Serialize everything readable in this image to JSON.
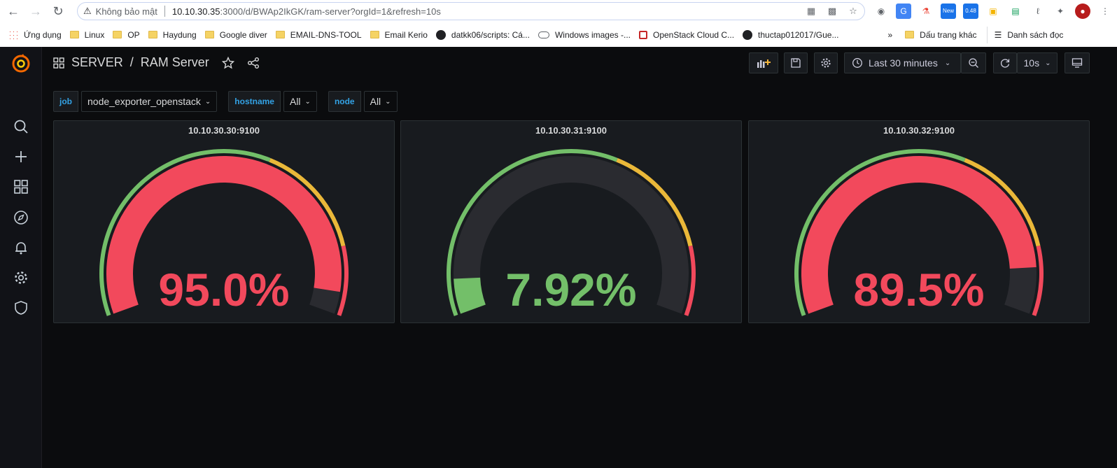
{
  "browser": {
    "security_label": "Không bảo mật",
    "url_host": "10.10.30.35",
    "url_rest": ":3000/d/BWAp2IkGK/ram-server?orgId=1&refresh=10s",
    "bookmarks": [
      {
        "label": "Ứng dụng",
        "icon": "apps-icon"
      },
      {
        "label": "Linux",
        "icon": "folder-icon"
      },
      {
        "label": "OP",
        "icon": "folder-icon"
      },
      {
        "label": "Haydung",
        "icon": "folder-icon"
      },
      {
        "label": "Google diver",
        "icon": "folder-icon"
      },
      {
        "label": "EMAIL-DNS-TOOL",
        "icon": "folder-icon"
      },
      {
        "label": "Email Kerio",
        "icon": "folder-icon"
      },
      {
        "label": "datkk06/scripts: Cá...",
        "icon": "github-icon"
      },
      {
        "label": "Windows images -...",
        "icon": "cloud-icon"
      },
      {
        "label": "OpenStack Cloud C...",
        "icon": "openstack-icon"
      },
      {
        "label": "thuctap012017/Gue...",
        "icon": "github-icon"
      }
    ],
    "more_label": "»",
    "other_bookmarks": "Dấu trang khác",
    "reading_list": "Danh sách đọc",
    "ext_badge": "0.48",
    "ext_new": "New"
  },
  "dashboard": {
    "folder": "SERVER",
    "title": "RAM Server",
    "time_range": "Last 30 minutes",
    "refresh": "10s",
    "variables": [
      {
        "label": "job",
        "value": "node_exporter_openstack"
      },
      {
        "label": "hostname",
        "value": "All"
      },
      {
        "label": "node",
        "value": "All"
      }
    ]
  },
  "colors": {
    "red": "#f2495c",
    "green": "#73bf69",
    "orange": "#eab839",
    "track": "#2a2b30"
  },
  "chart_data": [
    {
      "type": "gauge",
      "title": "10.10.30.30:9100",
      "value": 95.0,
      "display": "95.0%",
      "min": 0,
      "max": 100,
      "thresholds": [
        {
          "from": 0,
          "color": "green"
        },
        {
          "from": 60,
          "color": "orange"
        },
        {
          "from": 85,
          "color": "red"
        }
      ]
    },
    {
      "type": "gauge",
      "title": "10.10.30.31:9100",
      "value": 7.92,
      "display": "7.92%",
      "min": 0,
      "max": 100,
      "thresholds": [
        {
          "from": 0,
          "color": "green"
        },
        {
          "from": 60,
          "color": "orange"
        },
        {
          "from": 85,
          "color": "red"
        }
      ]
    },
    {
      "type": "gauge",
      "title": "10.10.30.32:9100",
      "value": 89.5,
      "display": "89.5%",
      "min": 0,
      "max": 100,
      "thresholds": [
        {
          "from": 0,
          "color": "green"
        },
        {
          "from": 60,
          "color": "orange"
        },
        {
          "from": 85,
          "color": "red"
        }
      ]
    }
  ]
}
